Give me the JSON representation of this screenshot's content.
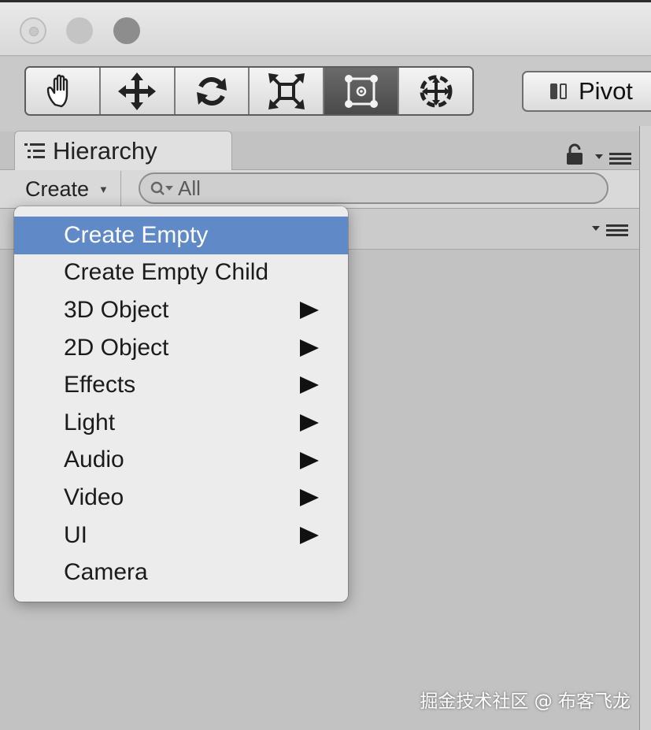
{
  "window": {
    "controls": [
      "close",
      "minimize",
      "zoom"
    ]
  },
  "toolbar": {
    "tools": [
      {
        "name": "hand-tool",
        "icon": "hand-icon",
        "active": false
      },
      {
        "name": "move-tool",
        "icon": "move-arrows-icon",
        "active": false
      },
      {
        "name": "rotate-tool",
        "icon": "rotate-icon",
        "active": false
      },
      {
        "name": "scale-tool",
        "icon": "scale-icon",
        "active": false
      },
      {
        "name": "rect-tool",
        "icon": "rect-transform-icon",
        "active": true
      },
      {
        "name": "transform-tool",
        "icon": "transform-icon",
        "active": false
      }
    ],
    "pivot_label": "Pivot"
  },
  "hierarchy": {
    "tab_label": "Hierarchy",
    "create_label": "Create",
    "search_placeholder": "All"
  },
  "create_menu": {
    "items": [
      {
        "label": "Create Empty",
        "submenu": false,
        "highlighted": true
      },
      {
        "label": "Create Empty Child",
        "submenu": false,
        "highlighted": false
      },
      {
        "label": "3D Object",
        "submenu": true,
        "highlighted": false
      },
      {
        "label": "2D Object",
        "submenu": true,
        "highlighted": false
      },
      {
        "label": "Effects",
        "submenu": true,
        "highlighted": false
      },
      {
        "label": "Light",
        "submenu": true,
        "highlighted": false
      },
      {
        "label": "Audio",
        "submenu": true,
        "highlighted": false
      },
      {
        "label": "Video",
        "submenu": true,
        "highlighted": false
      },
      {
        "label": "UI",
        "submenu": true,
        "highlighted": false
      },
      {
        "label": "Camera",
        "submenu": false,
        "highlighted": false
      }
    ]
  },
  "watermark": "掘金技术社区 @ 布客飞龙",
  "colors": {
    "highlight": "#5f8ac7",
    "panel": "#c2c2c2",
    "menu": "#ececec"
  }
}
